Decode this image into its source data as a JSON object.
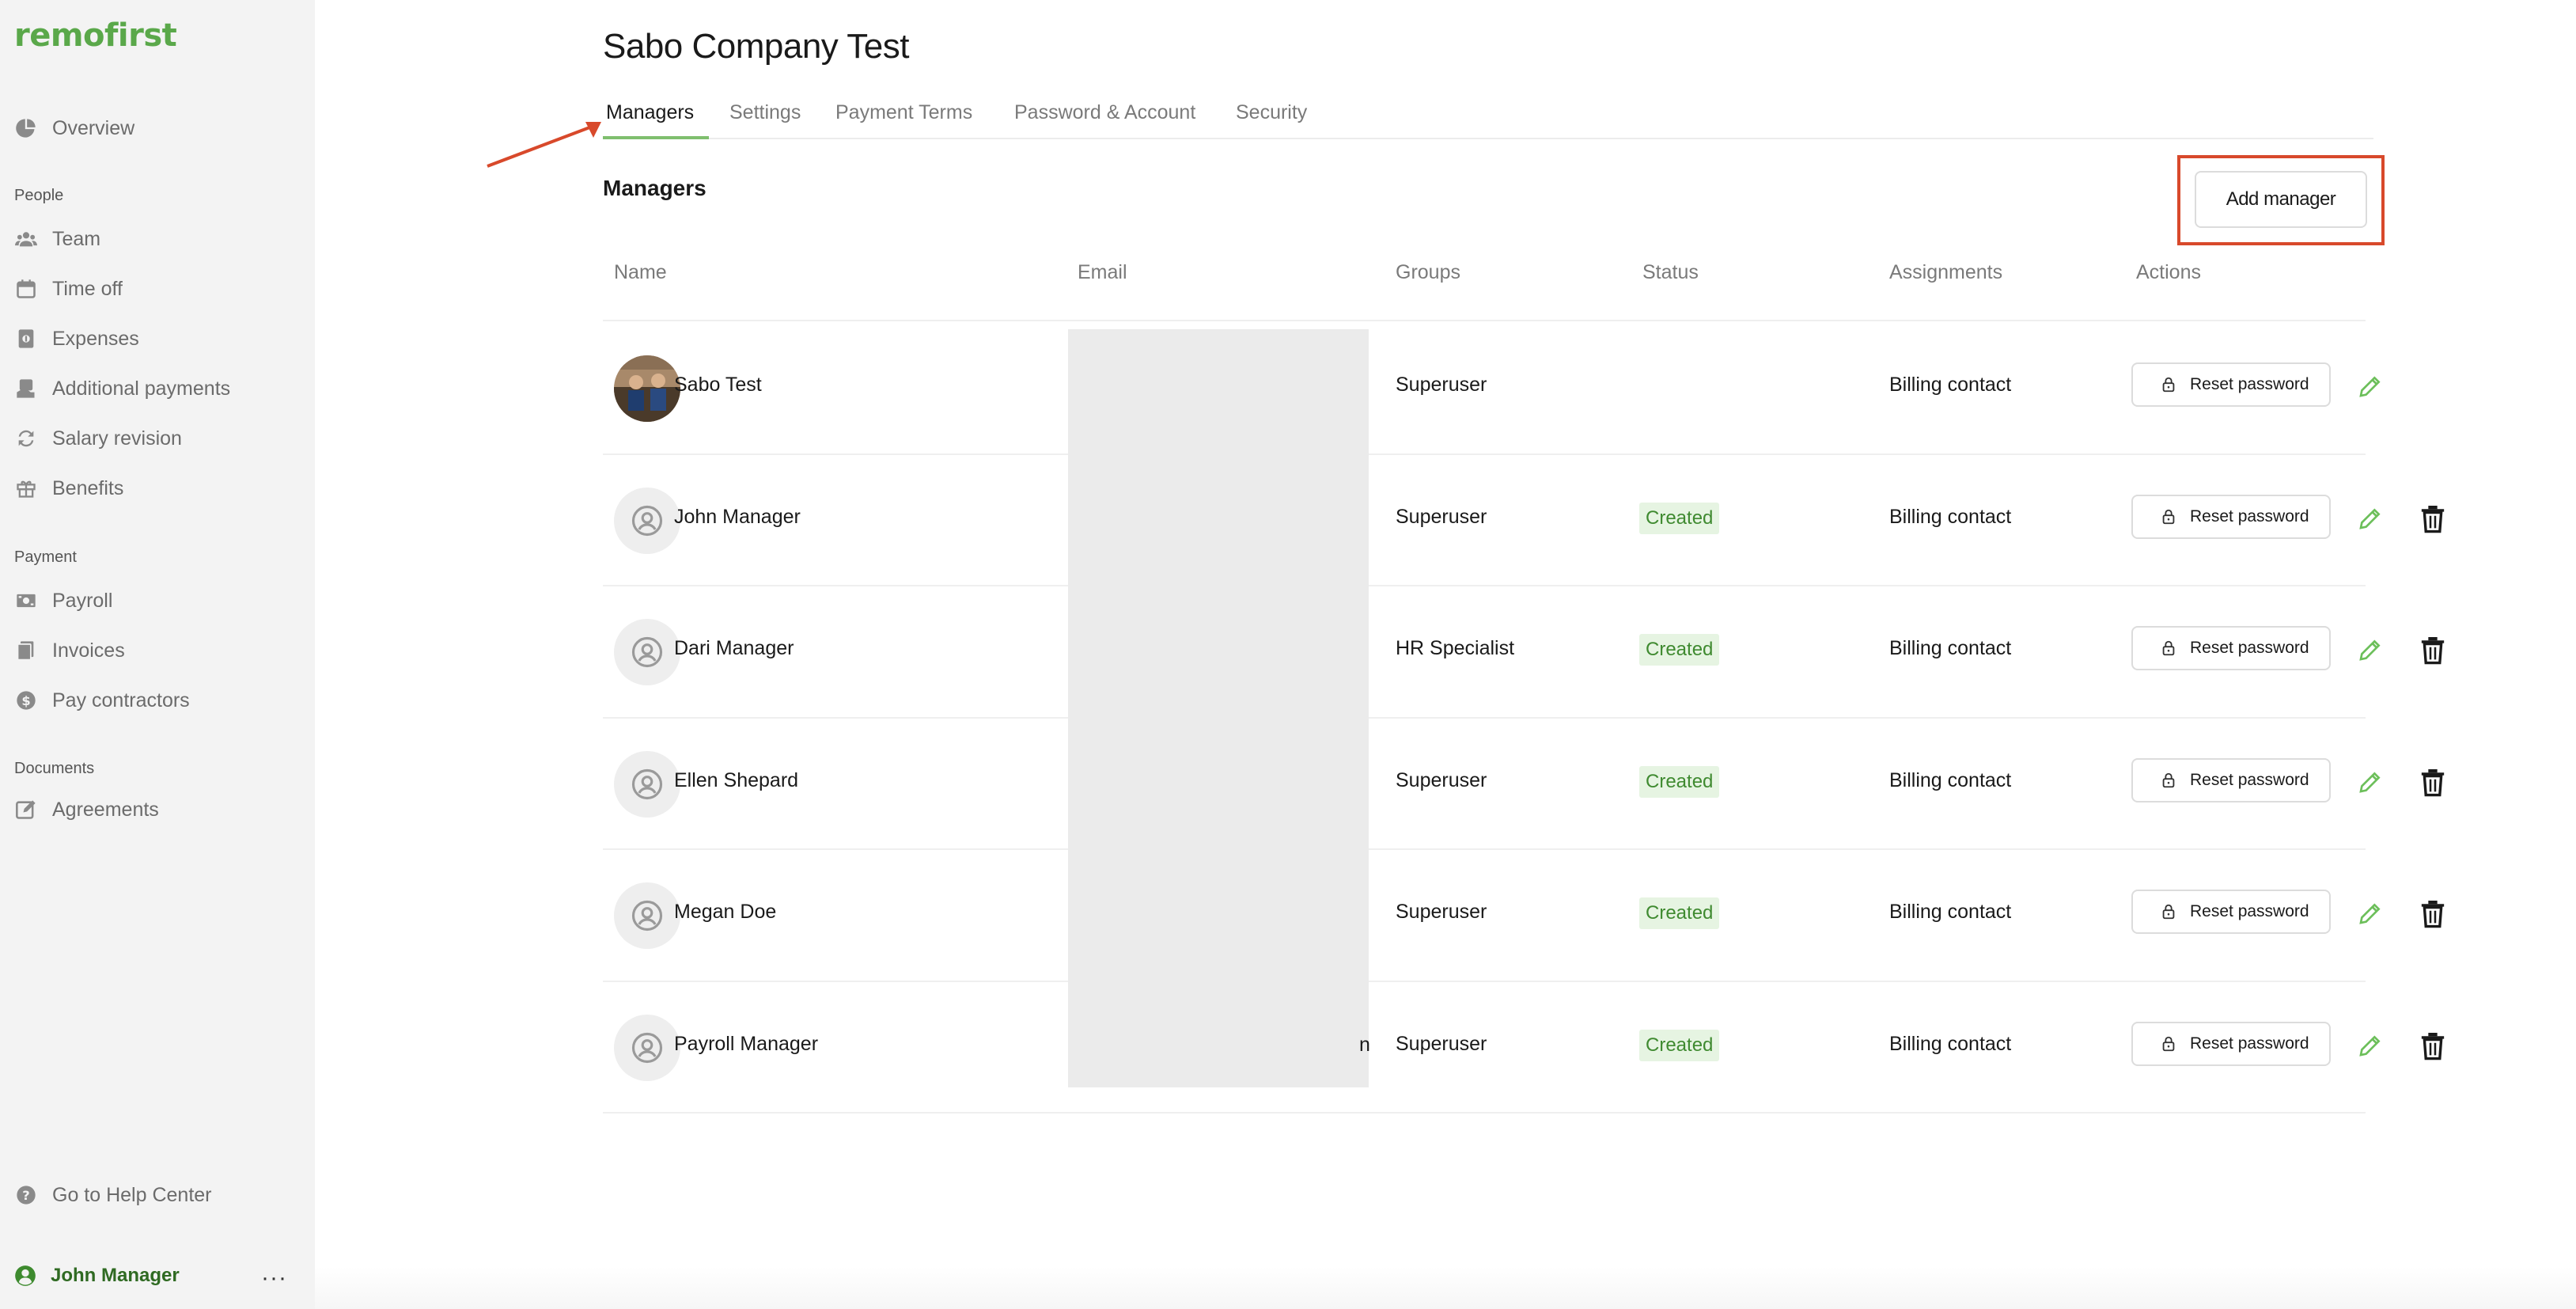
{
  "brand": {
    "logo": "remofirst",
    "accent": "#5aa84a"
  },
  "sidebar": {
    "overview": {
      "label": "Overview",
      "icon": "pie-chart-icon"
    },
    "sections": [
      {
        "label": "People"
      },
      {
        "label": "Payment"
      },
      {
        "label": "Documents"
      }
    ],
    "people_items": [
      {
        "label": "Team",
        "icon": "team-icon"
      },
      {
        "label": "Time off",
        "icon": "calendar-icon"
      },
      {
        "label": "Expenses",
        "icon": "receipt-icon"
      },
      {
        "label": "Additional payments",
        "icon": "payment-icon"
      },
      {
        "label": "Salary revision",
        "icon": "refresh-icon"
      },
      {
        "label": "Benefits",
        "icon": "gift-icon"
      }
    ],
    "payment_items": [
      {
        "label": "Payroll",
        "icon": "money-icon"
      },
      {
        "label": "Invoices",
        "icon": "invoice-icon"
      },
      {
        "label": "Pay contractors",
        "icon": "dollar-icon"
      }
    ],
    "document_items": [
      {
        "label": "Agreements",
        "icon": "edit-document-icon"
      }
    ],
    "help": {
      "label": "Go to Help Center",
      "icon": "help-icon"
    },
    "user": {
      "name": "John Manager",
      "more": "···"
    }
  },
  "page": {
    "title": "Sabo Company Test",
    "tabs": [
      {
        "label": "Managers",
        "active": true
      },
      {
        "label": "Settings"
      },
      {
        "label": "Payment Terms"
      },
      {
        "label": "Password & Account"
      },
      {
        "label": "Security"
      }
    ],
    "section_title": "Managers",
    "add_button": "Add manager"
  },
  "table": {
    "headers": [
      "Name",
      "Email",
      "Groups",
      "Status",
      "Assignments",
      "Actions"
    ],
    "reset_label": "Reset password",
    "email_peek": "n",
    "rows": [
      {
        "name": "Sabo Test",
        "group": "Superuser",
        "status": "",
        "assignment": "Billing contact",
        "photo": true,
        "deletable": false
      },
      {
        "name": "John Manager",
        "group": "Superuser",
        "status": "Created",
        "assignment": "Billing contact",
        "photo": false,
        "deletable": true
      },
      {
        "name": "Dari Manager",
        "group": "HR Specialist",
        "status": "Created",
        "assignment": "Billing contact",
        "photo": false,
        "deletable": true
      },
      {
        "name": "Ellen Shepard",
        "group": "Superuser",
        "status": "Created",
        "assignment": "Billing contact",
        "photo": false,
        "deletable": true
      },
      {
        "name": "Megan Doe",
        "group": "Superuser",
        "status": "Created",
        "assignment": "Billing contact",
        "photo": false,
        "deletable": true
      },
      {
        "name": "Payroll Manager",
        "group": "Superuser",
        "status": "Created",
        "assignment": "Billing contact",
        "photo": false,
        "deletable": true
      }
    ]
  }
}
